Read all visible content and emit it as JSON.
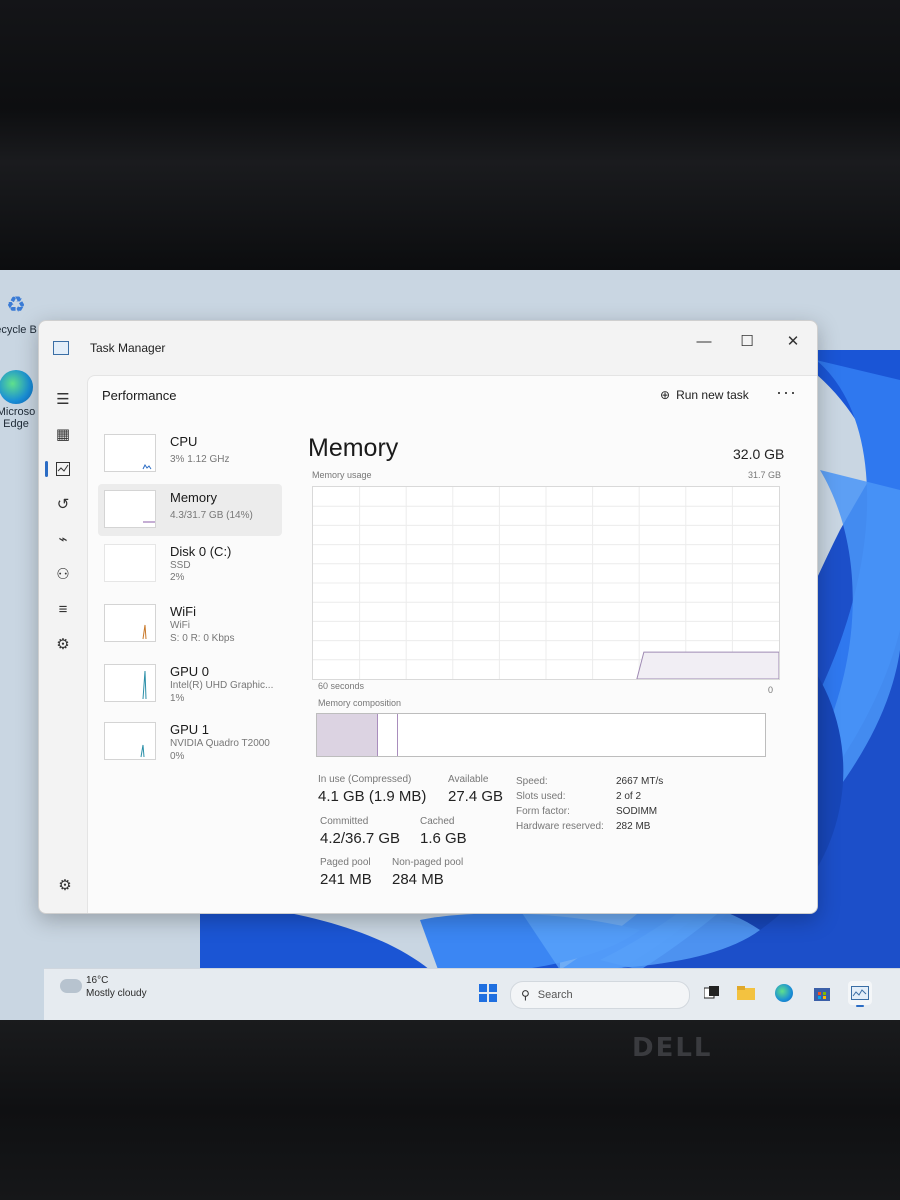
{
  "desktop": {
    "recycle_bin_label": "ecycle B",
    "edge_label_1": "Microso",
    "edge_label_2": "Edge"
  },
  "window": {
    "title": "Task Manager",
    "minimize_glyph": "—",
    "maximize_glyph": "☐",
    "close_glyph": "✕"
  },
  "header": {
    "section_title": "Performance",
    "run_new_task_label": "Run new task",
    "more_label": "···"
  },
  "sidebar": {
    "icons": [
      "hamburger-icon",
      "processes-icon",
      "performance-icon",
      "app-history-icon",
      "startup-apps-icon",
      "users-icon",
      "details-icon",
      "services-icon"
    ]
  },
  "devices": [
    {
      "name": "CPU",
      "sub1": "3% 1.12 GHz",
      "sub2": "",
      "sub3": ""
    },
    {
      "name": "Memory",
      "sub1": "4.3/31.7 GB (14%)",
      "sub2": "",
      "sub3": ""
    },
    {
      "name": "Disk 0 (C:)",
      "sub1": "SSD",
      "sub2": "2%",
      "sub3": ""
    },
    {
      "name": "WiFi",
      "sub1": "WiFi",
      "sub2": "S: 0 R: 0 Kbps",
      "sub3": ""
    },
    {
      "name": "GPU 0",
      "sub1": "Intel(R) UHD Graphic...",
      "sub2": "1%",
      "sub3": ""
    },
    {
      "name": "GPU 1",
      "sub1": "NVIDIA Quadro T2000",
      "sub2": "0%",
      "sub3": ""
    }
  ],
  "memory": {
    "title": "Memory",
    "total": "32.0 GB",
    "usage_label": "Memory usage",
    "usage_max": "31.7 GB",
    "axis_left": "60 seconds",
    "axis_right": "0",
    "composition_label": "Memory composition",
    "usage_fraction": 0.14,
    "stats": {
      "in_use_label": "In use (Compressed)",
      "in_use_value": "4.1 GB (1.9 MB)",
      "available_label": "Available",
      "available_value": "27.4 GB",
      "committed_label": "Committed",
      "committed_value": "4.2/36.7 GB",
      "cached_label": "Cached",
      "cached_value": "1.6 GB",
      "paged_pool_label": "Paged pool",
      "paged_pool_value": "241 MB",
      "nonpaged_pool_label": "Non-paged pool",
      "nonpaged_pool_value": "284 MB"
    },
    "details": [
      {
        "label": "Speed:",
        "value": "2667 MT/s"
      },
      {
        "label": "Slots used:",
        "value": "2 of 2"
      },
      {
        "label": "Form factor:",
        "value": "SODIMM"
      },
      {
        "label": "Hardware reserved:",
        "value": "282 MB"
      }
    ]
  },
  "taskbar": {
    "temperature": "16°C",
    "weather": "Mostly cloudy",
    "search_placeholder": "Search"
  },
  "monitor": {
    "brand": "DELL"
  },
  "colors": {
    "accent": "#2b6cc4",
    "window_bg": "#f3f3f3",
    "wallpaper_blue": "#1f5fe0"
  }
}
